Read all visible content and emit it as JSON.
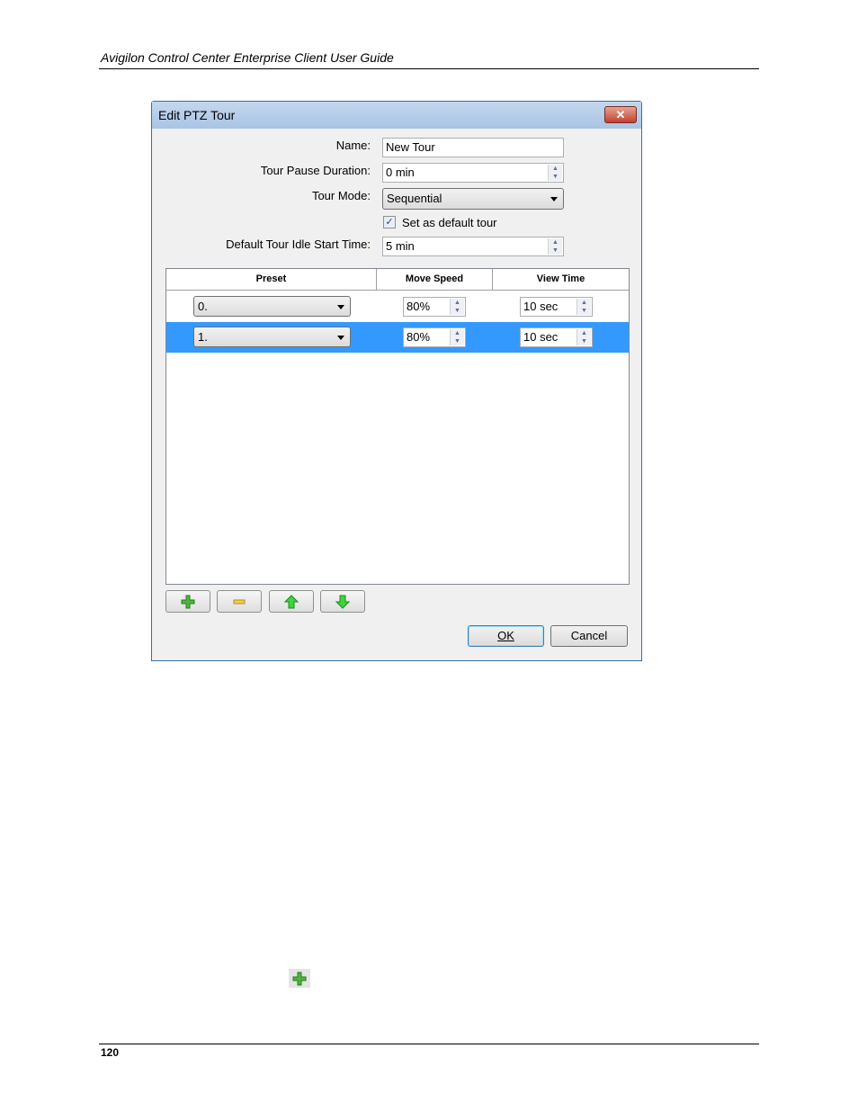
{
  "page": {
    "header": "Avigilon Control Center Enterprise Client User Guide",
    "page_number": "120"
  },
  "dialog": {
    "title": "Edit PTZ Tour",
    "close_label": "✕",
    "fields": {
      "name_label": "Name:",
      "name_value": "New Tour",
      "pause_label": "Tour Pause Duration:",
      "pause_value": "0 min",
      "mode_label": "Tour Mode:",
      "mode_value": "Sequential",
      "default_label": "Set as default tour",
      "default_checked": true,
      "idle_label": "Default Tour Idle Start Time:",
      "idle_value": "5 min"
    },
    "grid": {
      "columns": [
        "Preset",
        "Move Speed",
        "View Time"
      ],
      "rows": [
        {
          "preset": "0.",
          "speed": "80%",
          "view": "10 sec",
          "selected": false
        },
        {
          "preset": "1.",
          "speed": "80%",
          "view": "10 sec",
          "selected": true
        }
      ]
    },
    "toolbar": [
      "add-icon",
      "remove-icon",
      "move-up-icon",
      "move-down-icon"
    ],
    "ok_label": "OK",
    "cancel_label": "Cancel"
  },
  "colors": {
    "selection": "#3399ff",
    "title_bar": "#b9cfea"
  }
}
